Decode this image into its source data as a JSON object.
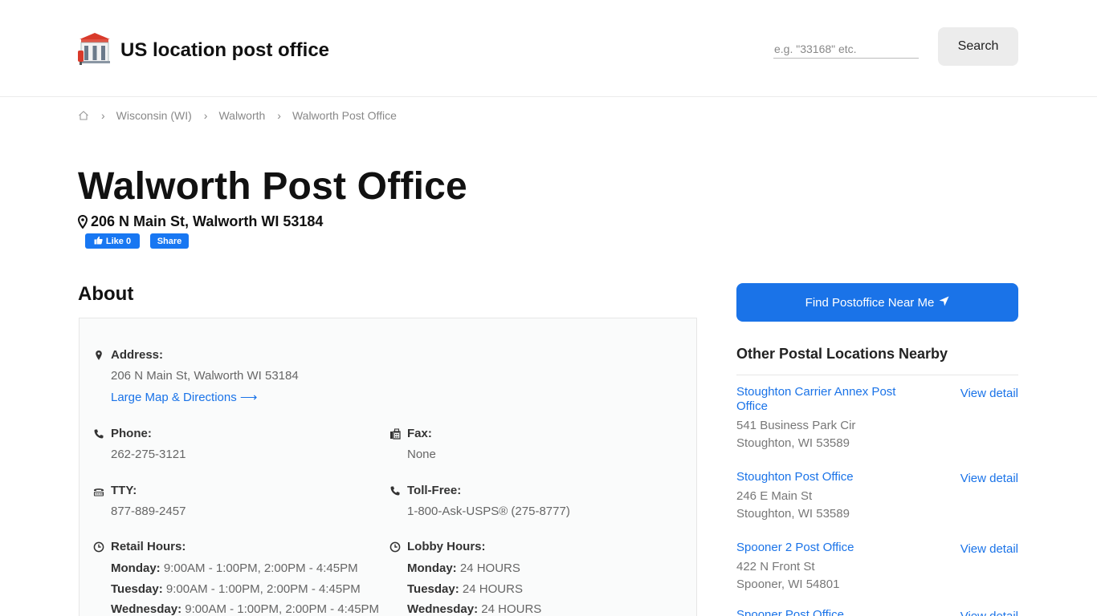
{
  "header": {
    "site_title": "US location post office",
    "search_placeholder": "e.g. \"33168\" etc.",
    "search_label": "Search"
  },
  "breadcrumb": {
    "items": [
      "Wisconsin (WI)",
      "Walworth",
      "Walworth Post Office"
    ]
  },
  "page": {
    "title": "Walworth Post Office",
    "address": "206 N Main St, Walworth WI 53184",
    "fb_like": "Like 0",
    "fb_share": "Share"
  },
  "about": {
    "heading": "About",
    "address_label": "Address:",
    "address_value": "206 N Main St, Walworth WI 53184",
    "map_link": "Large Map & Directions ⟶",
    "phone_label": "Phone:",
    "phone_value": "262-275-3121",
    "fax_label": "Fax:",
    "fax_value": "None",
    "tty_label": "TTY:",
    "tty_value": "877-889-2457",
    "tollfree_label": "Toll-Free:",
    "tollfree_value": "1-800-Ask-USPS® (275-8777)",
    "retail_label": "Retail Hours:",
    "retail_hours": [
      {
        "day": "Monday:",
        "hours": "9:00AM - 1:00PM, 2:00PM - 4:45PM"
      },
      {
        "day": "Tuesday:",
        "hours": "9:00AM - 1:00PM, 2:00PM - 4:45PM"
      },
      {
        "day": "Wednesday:",
        "hours": "9:00AM - 1:00PM, 2:00PM - 4:45PM"
      }
    ],
    "lobby_label": "Lobby Hours:",
    "lobby_hours": [
      {
        "day": "Monday:",
        "hours": "24 HOURS"
      },
      {
        "day": "Tuesday:",
        "hours": "24 HOURS"
      },
      {
        "day": "Wednesday:",
        "hours": "24 HOURS"
      }
    ]
  },
  "sidebar": {
    "find_button": "Find Postoffice Near Me",
    "nearby_heading": "Other Postal Locations Nearby",
    "view_detail": "View detail",
    "nearby": [
      {
        "name": "Stoughton Carrier Annex Post Office",
        "line1": "541 Business Park Cir",
        "line2": "Stoughton, WI 53589"
      },
      {
        "name": "Stoughton Post Office",
        "line1": "246 E Main St",
        "line2": "Stoughton, WI 53589"
      },
      {
        "name": "Spooner 2 Post Office",
        "line1": "422 N Front St",
        "line2": "Spooner, WI 54801"
      },
      {
        "name": "Spooner Post Office",
        "line1": "",
        "line2": ""
      }
    ]
  },
  "colors": {
    "accent": "#1a73e8",
    "facebook": "#1877f2",
    "logo_red": "#d93a2b"
  }
}
